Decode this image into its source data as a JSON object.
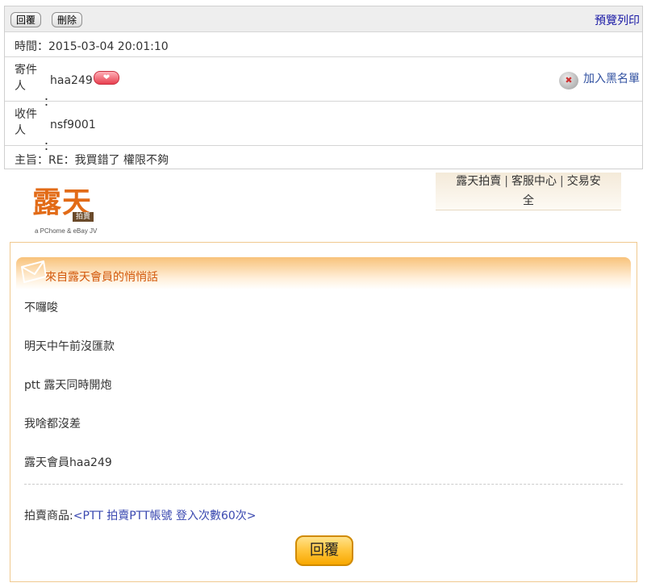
{
  "toolbar": {
    "reply_label": "回覆",
    "delete_label": "刪除",
    "print_label": "預覽列印"
  },
  "header": {
    "time_label": "時間：",
    "time_value": "2015-03-04 20:01:10",
    "from_label": "寄件人",
    "from_colon": "：",
    "from_value": "haa249",
    "blacklist_label": "加入黑名單",
    "to_label": "收件人",
    "to_colon": "：",
    "to_value": "nsf9001",
    "subject_label": "主旨：",
    "subject_value": "RE：我買錯了 權限不夠"
  },
  "logo": {
    "main": "露天",
    "tag": "拍賣",
    "sub": "a PChome & eBay JV"
  },
  "topnav": {
    "links": [
      "露天拍賣",
      "客服中心",
      "交易安"
    ],
    "separator": "|",
    "wrap": "全"
  },
  "message": {
    "title": "來自露天會員的悄悄話",
    "lines": [
      "不囉唆",
      "明天中午前沒匯款",
      "ptt 露天同時開炮",
      "我啥都沒差",
      "露天會員haa249"
    ],
    "goods_label": "拍賣商品:",
    "goods_item": "<PTT 拍賣PTT帳號 登入次數60次>",
    "reply_button": "回覆"
  }
}
